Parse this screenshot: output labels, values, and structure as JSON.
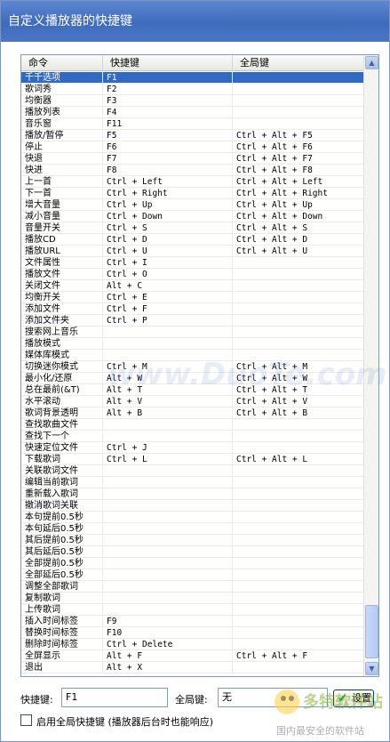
{
  "window": {
    "title": "自定义播放器的快捷键"
  },
  "table": {
    "headers": [
      "命令",
      "快捷键",
      "全局键"
    ],
    "rows": [
      [
        "千千选项",
        "F1",
        ""
      ],
      [
        "歌词秀",
        "F2",
        ""
      ],
      [
        "均衡器",
        "F3",
        ""
      ],
      [
        "播放列表",
        "F4",
        ""
      ],
      [
        "音乐窗",
        "F11",
        ""
      ],
      [
        "播放/暂停",
        "F5",
        "Ctrl + Alt + F5"
      ],
      [
        "停止",
        "F6",
        "Ctrl + Alt + F6"
      ],
      [
        "快退",
        "F7",
        "Ctrl + Alt + F7"
      ],
      [
        "快进",
        "F8",
        "Ctrl + Alt + F8"
      ],
      [
        "上一首",
        "Ctrl + Left",
        "Ctrl + Alt + Left"
      ],
      [
        "下一首",
        "Ctrl + Right",
        "Ctrl + Alt + Right"
      ],
      [
        "增大音量",
        "Ctrl + Up",
        "Ctrl + Alt + Up"
      ],
      [
        "减小音量",
        "Ctrl + Down",
        "Ctrl + Alt + Down"
      ],
      [
        "音量开关",
        "Ctrl + S",
        "Ctrl + Alt + S"
      ],
      [
        "播放CD",
        "Ctrl + D",
        "Ctrl + Alt + D"
      ],
      [
        "播放URL",
        "Ctrl + U",
        "Ctrl + Alt + U"
      ],
      [
        "文件属性",
        "Ctrl + I",
        ""
      ],
      [
        "播放文件",
        "Ctrl + O",
        ""
      ],
      [
        "关闭文件",
        "Alt + C",
        ""
      ],
      [
        "均衡开关",
        "Ctrl + E",
        ""
      ],
      [
        "添加文件",
        "Ctrl + F",
        ""
      ],
      [
        "添加文件夹",
        "Ctrl + P",
        ""
      ],
      [
        "搜索网上音乐",
        "",
        ""
      ],
      [
        "播放模式",
        "",
        ""
      ],
      [
        "媒体库模式",
        "",
        ""
      ],
      [
        "切换迷你模式",
        "Ctrl + M",
        "Ctrl + Alt + M"
      ],
      [
        "最小化/还原",
        "Alt + W",
        "Ctrl + Alt + W"
      ],
      [
        "总在最前(&T)",
        "Alt + T",
        "Ctrl + Alt + T"
      ],
      [
        "水平滚动",
        "Alt + V",
        "Ctrl + Alt + V"
      ],
      [
        "歌词背景透明",
        "Alt + B",
        "Ctrl + Alt + B"
      ],
      [
        "查找歌曲文件",
        "",
        ""
      ],
      [
        "查找下一个",
        "",
        ""
      ],
      [
        "快速定位文件",
        "Ctrl + J",
        ""
      ],
      [
        "下载歌词",
        "Ctrl + L",
        "Ctrl + Alt + L"
      ],
      [
        "关联歌词文件",
        "",
        ""
      ],
      [
        "编辑当前歌词",
        "",
        ""
      ],
      [
        "重新载入歌词",
        "",
        ""
      ],
      [
        "撤消歌词关联",
        "",
        ""
      ],
      [
        "本句提前0.5秒",
        "",
        ""
      ],
      [
        "本句延后0.5秒",
        "",
        ""
      ],
      [
        "其后提前0.5秒",
        "",
        ""
      ],
      [
        "其后延后0.5秒",
        "",
        ""
      ],
      [
        "全部提前0.5秒",
        "",
        ""
      ],
      [
        "全部延后0.5秒",
        "",
        ""
      ],
      [
        "调整全部歌词",
        "",
        ""
      ],
      [
        "复制歌词",
        "",
        ""
      ],
      [
        "上传歌词",
        "",
        ""
      ],
      [
        "插入时间标签",
        "F9",
        ""
      ],
      [
        "替换时间标签",
        "F10",
        ""
      ],
      [
        "删除时间标签",
        "Ctrl + Delete",
        ""
      ],
      [
        "全屏显示",
        "Alt + F",
        "Ctrl + Alt + F"
      ],
      [
        "退出",
        "Alt + X",
        ""
      ]
    ],
    "selected_index": 0
  },
  "form": {
    "hotkey_label": "快捷键:",
    "hotkey_value": "F1",
    "global_label": "全局键:",
    "global_value": "无",
    "set_button": "设置"
  },
  "checkbox": {
    "label": "启用全局快捷键 (播放器后台时也能响应)",
    "checked": false
  },
  "watermark": {
    "site": "www.DuoTe.com",
    "logo_text": "多特软件站",
    "logo_sub": "国内最安全的软件站"
  },
  "colors": {
    "titlebar": "#3f6bbd",
    "selection": "#316ac5",
    "accent_green": "#1a9a2a"
  }
}
